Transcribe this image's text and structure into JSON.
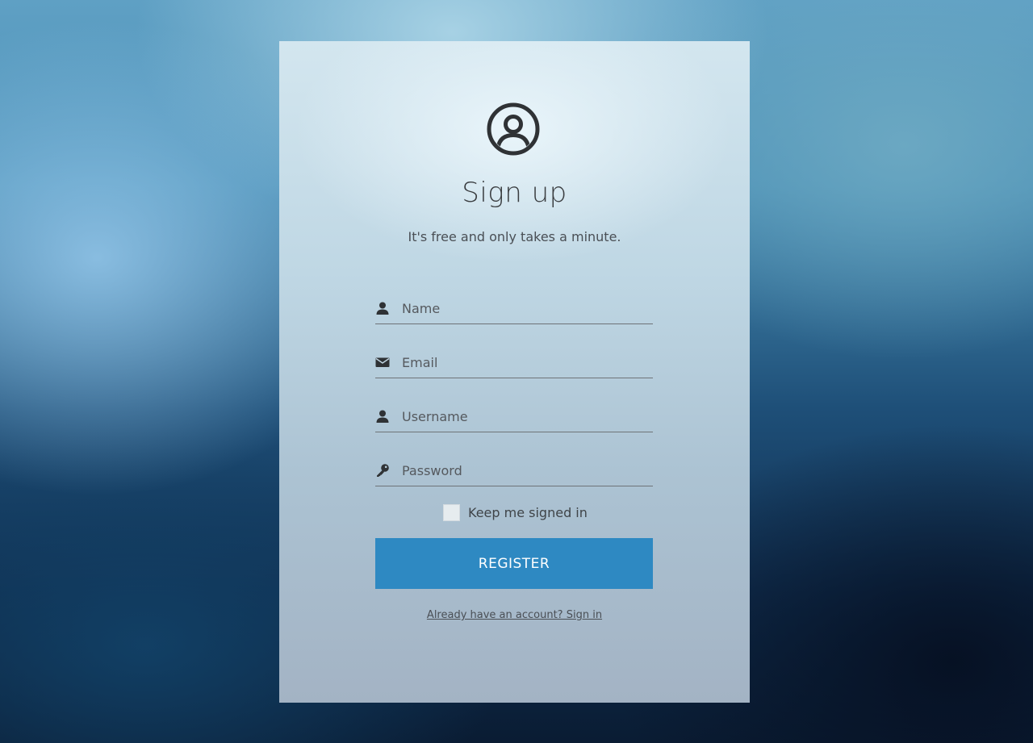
{
  "header": {
    "avatar_icon": "user-circle-icon",
    "title": "Sign up",
    "subtitle": "It's free and only takes a minute."
  },
  "form": {
    "fields": [
      {
        "icon": "user-icon",
        "placeholder": "Name",
        "value": ""
      },
      {
        "icon": "envelope-icon",
        "placeholder": "Email",
        "value": ""
      },
      {
        "icon": "user-icon",
        "placeholder": "Username",
        "value": ""
      },
      {
        "icon": "key-icon",
        "placeholder": "Password",
        "value": ""
      }
    ],
    "remember_label": "Keep me signed in",
    "remember_checked": false,
    "register_label": "REGISTER",
    "signin_link": "Already have an account? Sign in"
  },
  "colors": {
    "accent": "#2e89c2",
    "text": "#3a3d40"
  }
}
